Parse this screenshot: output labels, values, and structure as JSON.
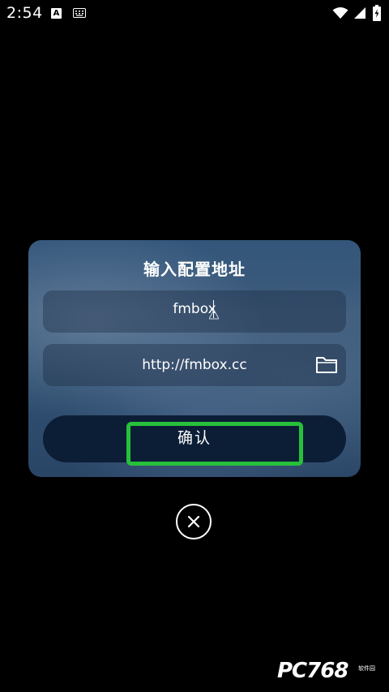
{
  "status_bar": {
    "time": "2:54",
    "icons": [
      "a-notification-icon",
      "keyboard-icon",
      "wifi-icon",
      "signal-icon",
      "battery-icon"
    ]
  },
  "dialog": {
    "title": "输入配置地址",
    "name_field_value": "fmbox",
    "url_field_value": "http://fmbox.cc",
    "folder_icon": "folder-icon",
    "confirm_label": "确认"
  },
  "close_icon": "close-icon",
  "watermark": {
    "text": "PC768",
    "sub": "软件园"
  },
  "colors": {
    "background": "#000000",
    "dialog_bg": "#3d5b7c",
    "button_bg": "#0c1e36",
    "highlight": "#27c03a",
    "text": "#ffffff"
  }
}
